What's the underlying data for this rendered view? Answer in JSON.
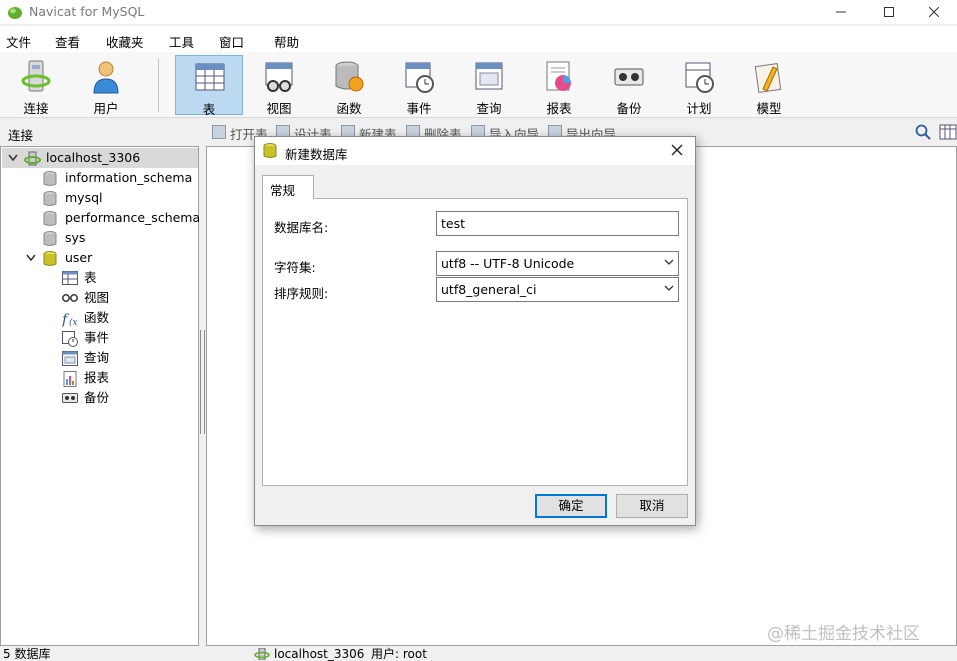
{
  "window": {
    "title": "Navicat for MySQL"
  },
  "menu": [
    "文件",
    "查看",
    "收藏夹",
    "工具",
    "窗口",
    "帮助"
  ],
  "toolbar": [
    {
      "label": "连接",
      "icon": "connection-icon"
    },
    {
      "label": "用户",
      "icon": "user-icon"
    },
    {
      "label": "表",
      "icon": "table-icon",
      "active": true
    },
    {
      "label": "视图",
      "icon": "view-icon"
    },
    {
      "label": "函数",
      "icon": "function-icon"
    },
    {
      "label": "事件",
      "icon": "event-icon"
    },
    {
      "label": "查询",
      "icon": "query-icon"
    },
    {
      "label": "报表",
      "icon": "report-icon"
    },
    {
      "label": "备份",
      "icon": "backup-icon"
    },
    {
      "label": "计划",
      "icon": "schedule-icon"
    },
    {
      "label": "模型",
      "icon": "model-icon"
    }
  ],
  "connection_header": "连接",
  "object_toolbar": [
    "打开表",
    "设计表",
    "新建表",
    "删除表",
    "导入向导",
    "导出向导"
  ],
  "tree": {
    "connection": "localhost_3306",
    "databases": [
      "information_schema",
      "mysql",
      "performance_schema",
      "sys",
      "user"
    ],
    "user_children": [
      "表",
      "视图",
      "函数",
      "事件",
      "查询",
      "报表",
      "备份"
    ]
  },
  "status": {
    "db_count": "5 数据库",
    "connection": "localhost_3306",
    "user": "用户: root"
  },
  "watermark": "@稀土掘金技术社区",
  "dialog": {
    "title": "新建数据库",
    "tab": "常规",
    "db_name_label": "数据库名:",
    "db_name_value": "test",
    "charset_label": "字符集:",
    "charset_value": "utf8 -- UTF-8 Unicode",
    "collation_label": "排序规则:",
    "collation_value": "utf8_general_ci",
    "ok_label": "确定",
    "cancel_label": "取消"
  },
  "colors": {
    "active_toolbar_bg": "#bcd9f2",
    "default_button_border": "#0078d7",
    "tree_selected_bg": "#d9d9d9"
  }
}
